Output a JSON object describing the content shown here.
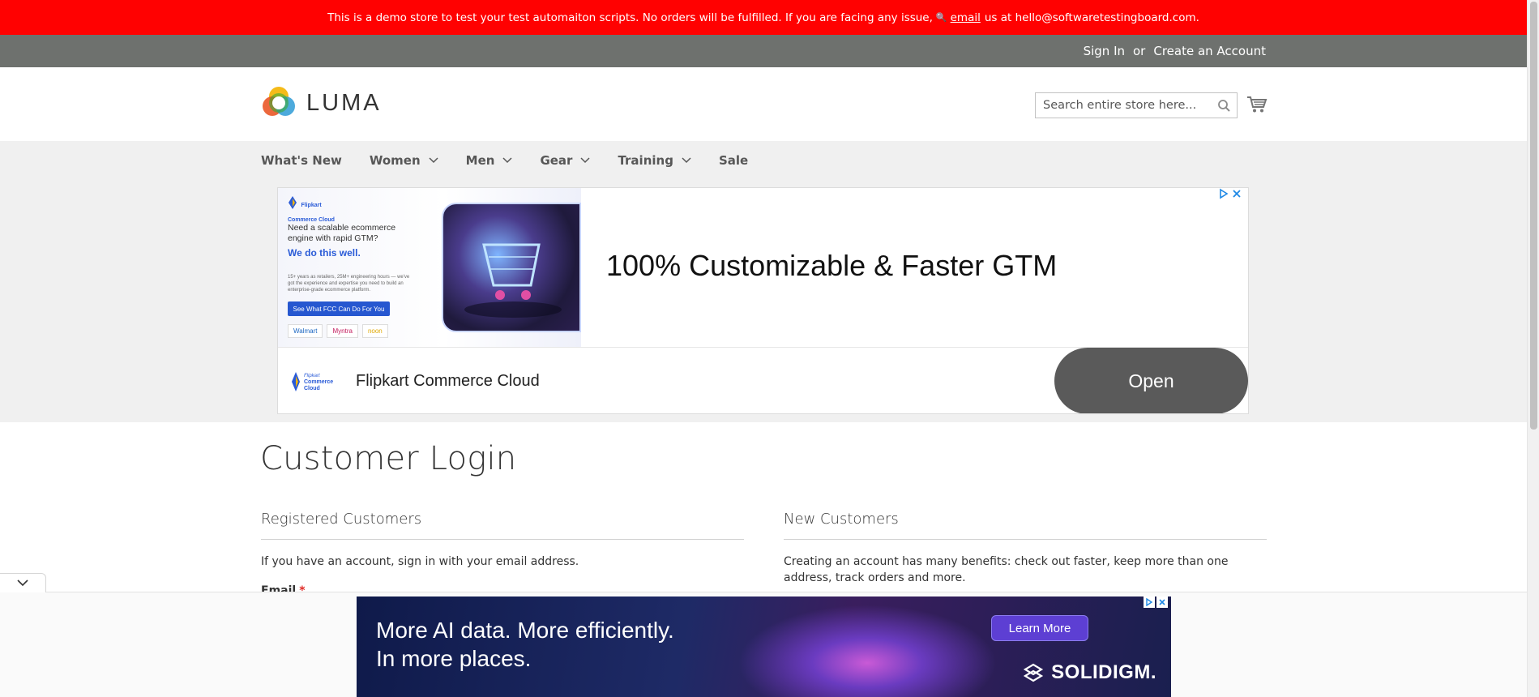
{
  "demo_notice": {
    "text_before": "This is a demo store to test your test automaiton scripts. No orders will be fulfilled. If you are facing any issue,",
    "link_text": "email",
    "text_after": "us at hello@softwaretestingboard.com."
  },
  "panel_header": {
    "sign_in": "Sign In",
    "or": "or",
    "create_account": "Create an Account"
  },
  "header": {
    "logo_text": "LUMA",
    "search_placeholder": "Search entire store here..."
  },
  "nav": {
    "items": [
      {
        "label": "What's New",
        "has_dropdown": false
      },
      {
        "label": "Women",
        "has_dropdown": true
      },
      {
        "label": "Men",
        "has_dropdown": true
      },
      {
        "label": "Gear",
        "has_dropdown": true
      },
      {
        "label": "Training",
        "has_dropdown": true
      },
      {
        "label": "Sale",
        "has_dropdown": false
      }
    ]
  },
  "ad_top": {
    "creative_logo": "Flipkart Commerce Cloud",
    "creative_line1": "Need a scalable ecommerce engine with rapid GTM?",
    "creative_line2": "We do this well.",
    "creative_line3": "15+ years as retailers, 25M+ engineering hours — we've got the experience and expertise you need to build an enterprise-grade ecommerce platform.",
    "creative_button": "See What FCC Can Do For You",
    "creative_brands": [
      "Walmart",
      "Myntra",
      "noon"
    ],
    "headline": "100% Customizable & Faster GTM",
    "advertiser": "Flipkart Commerce Cloud",
    "cta": "Open"
  },
  "main": {
    "page_title": "Customer Login",
    "registered": {
      "heading": "Registered Customers",
      "text": "If you have an account, sign in with your email address.",
      "email_label": "Email",
      "required_mark": "*"
    },
    "new_customers": {
      "heading": "New Customers",
      "text": "Creating an account has many benefits: check out faster, keep more than one address, track orders and more."
    }
  },
  "ad_bottom": {
    "line1": "More AI data. More efficiently.",
    "line2": "In more places.",
    "cta": "Learn More",
    "brand": "SOLIDIGM."
  },
  "colors": {
    "demo_bar": "#ff0101",
    "panel_header": "#6e716e",
    "nav_bg": "#f0f0f0",
    "required": "#e02b27"
  }
}
